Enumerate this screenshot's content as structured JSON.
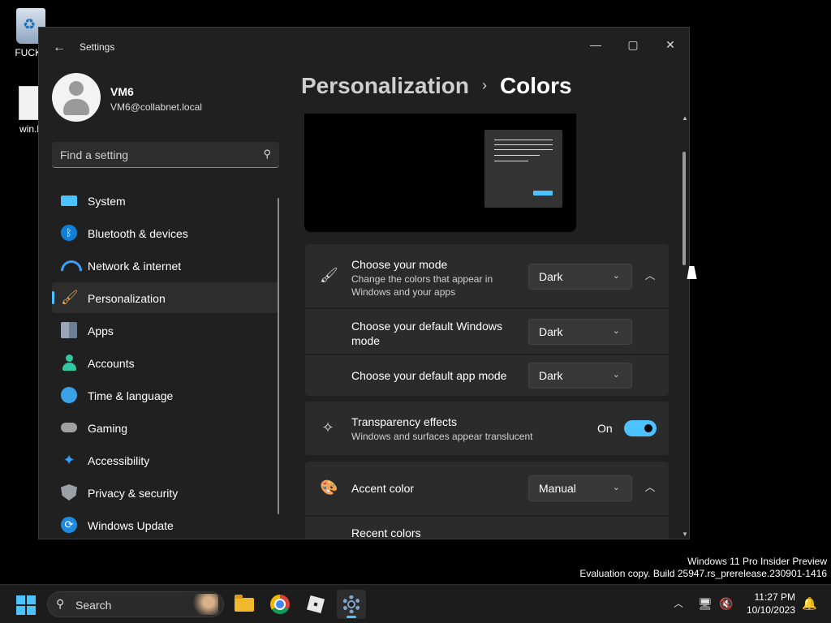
{
  "desktop": {
    "icons": [
      {
        "label": "FUCK I"
      },
      {
        "label": "win.b"
      }
    ]
  },
  "window": {
    "title": "Settings",
    "back_icon": "arrow-left-icon",
    "controls": {
      "minimize": "—",
      "maximize": "▢",
      "close": "✕"
    }
  },
  "profile": {
    "name": "VM6",
    "email": "VM6@collabnet.local"
  },
  "search": {
    "placeholder": "Find a setting",
    "icon": "search-icon"
  },
  "sidebar": {
    "items": [
      {
        "label": "System",
        "icon": "system-icon",
        "active": false
      },
      {
        "label": "Bluetooth & devices",
        "icon": "bluetooth-icon",
        "active": false
      },
      {
        "label": "Network & internet",
        "icon": "wifi-icon",
        "active": false
      },
      {
        "label": "Personalization",
        "icon": "brush-icon",
        "active": true
      },
      {
        "label": "Apps",
        "icon": "apps-icon",
        "active": false
      },
      {
        "label": "Accounts",
        "icon": "accounts-icon",
        "active": false
      },
      {
        "label": "Time & language",
        "icon": "globe-clock-icon",
        "active": false
      },
      {
        "label": "Gaming",
        "icon": "controller-icon",
        "active": false
      },
      {
        "label": "Accessibility",
        "icon": "accessibility-icon",
        "active": false
      },
      {
        "label": "Privacy & security",
        "icon": "shield-icon",
        "active": false
      },
      {
        "label": "Windows Update",
        "icon": "update-icon",
        "active": false
      }
    ]
  },
  "breadcrumb": {
    "parent": "Personalization",
    "separator": "›",
    "current": "Colors"
  },
  "mode": {
    "title": "Choose your mode",
    "description": "Change the colors that appear in Windows and your apps",
    "value": "Dark",
    "windows_mode_title": "Choose your default Windows mode",
    "windows_mode_value": "Dark",
    "app_mode_title": "Choose your default app mode",
    "app_mode_value": "Dark"
  },
  "transparency": {
    "title": "Transparency effects",
    "description": "Windows and surfaces appear translucent",
    "state_label": "On",
    "enabled": true
  },
  "accent": {
    "title": "Accent color",
    "value": "Manual",
    "recent_colors_title": "Recent colors"
  },
  "watermark": {
    "line1": "Windows 11 Pro Insider Preview",
    "line2": "Evaluation copy. Build 25947.rs_prerelease.230901-1416"
  },
  "taskbar": {
    "search_label": "Search",
    "apps": [
      "file-explorer-icon",
      "chrome-icon",
      "roblox-icon",
      "settings-icon"
    ],
    "time": "11:27 PM",
    "date": "10/10/2023"
  },
  "colors": {
    "accent": "#4cc2ff",
    "window_bg": "#202020",
    "card_bg": "#2b2b2b"
  }
}
